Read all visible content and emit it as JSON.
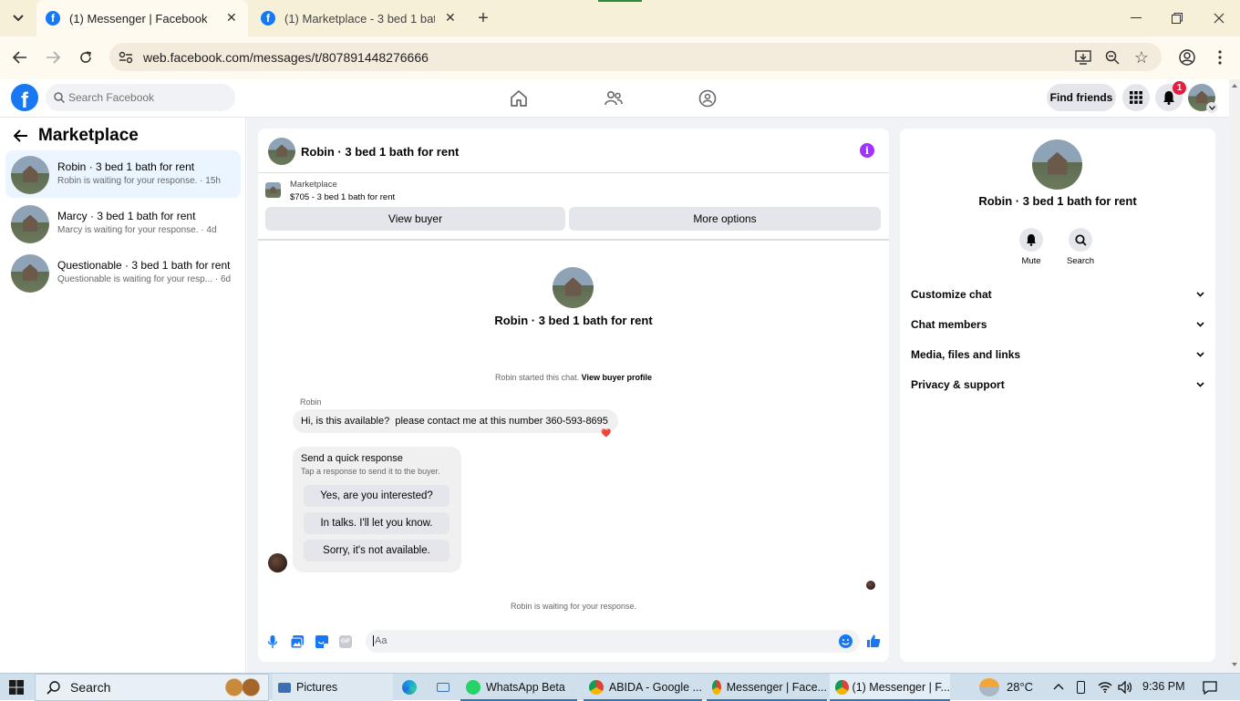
{
  "browser": {
    "tabs": [
      {
        "title": "(1) Messenger | Facebook",
        "active": true
      },
      {
        "title": "(1) Marketplace - 3 bed 1 bath f",
        "active": false
      }
    ],
    "url": "web.facebook.com/messages/t/807891448276666"
  },
  "fb_header": {
    "search_placeholder": "Search Facebook",
    "find_friends": "Find friends",
    "notification_count": "1"
  },
  "left_panel": {
    "title": "Marketplace",
    "conversations": [
      {
        "title": "Robin · 3 bed 1 bath for rent",
        "subtitle": "Robin is waiting for your response. · 15h",
        "selected": true
      },
      {
        "title": "Marcy · 3 bed 1 bath for rent",
        "subtitle": "Marcy is waiting for your response. · 4d",
        "selected": false
      },
      {
        "title": "Questionable · 3 bed 1 bath for rent",
        "subtitle": "Questionable is waiting for your resp...  · 6d",
        "selected": false
      }
    ]
  },
  "chat": {
    "title": "Robin · 3 bed 1 bath for rent",
    "listing_label": "Marketplace",
    "listing_title": "$705 - 3 bed 1 bath for rent",
    "view_buyer": "View buyer",
    "more_options": "More options",
    "intro_name": "Robin · 3 bed 1 bath for rent",
    "started_text": "Robin started this chat.",
    "view_buyer_profile": "View buyer profile",
    "sender_name": "Robin",
    "message": "Hi, is this available?  please contact me at this number 360-593-8695",
    "reaction": "❤️",
    "quick_title": "Send a quick response",
    "quick_sub": "Tap a response to send it to the buyer.",
    "quick_replies": [
      "Yes, are you interested?",
      "In talks. I'll let you know.",
      "Sorry, it's not available."
    ],
    "waiting_text": "Robin is waiting for your response.",
    "input_placeholder": "Aa"
  },
  "info_panel": {
    "name": "Robin · 3 bed 1 bath for rent",
    "mute_label": "Mute",
    "search_label": "Search",
    "sections": [
      "Customize chat",
      "Chat members",
      "Media, files and links",
      "Privacy & support"
    ]
  },
  "taskbar": {
    "search_label": "Search",
    "apps": [
      {
        "label": "Pictures"
      },
      {
        "label": "WhatsApp Beta"
      },
      {
        "label": "ABIDA - Google ..."
      },
      {
        "label": "Messenger | Face..."
      },
      {
        "label": "(1) Messenger | F..."
      }
    ],
    "temperature": "28°C",
    "time": "9:36 PM"
  },
  "colors": {
    "fb_blue": "#1877f2",
    "purple": "#a033ff",
    "selected_bg": "#ebf5ff"
  }
}
